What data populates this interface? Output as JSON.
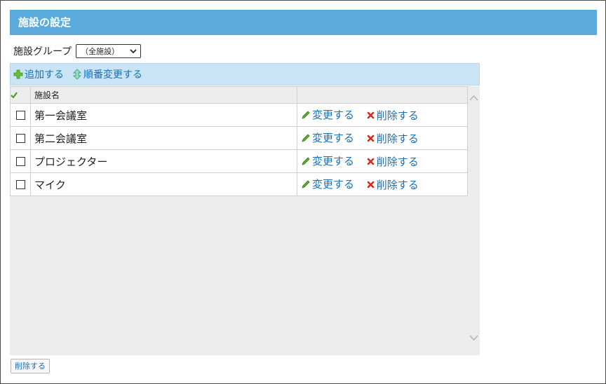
{
  "header": {
    "title": "施設の設定"
  },
  "group_filter": {
    "label": "施設グループ",
    "selected": "（全施設）"
  },
  "toolbar": {
    "add_label": "追加する",
    "reorder_label": "順番変更する"
  },
  "table": {
    "column_name": "施設名",
    "rows": [
      {
        "name": "第一会議室",
        "edit_label": "変更する",
        "delete_label": "削除する"
      },
      {
        "name": "第二会議室",
        "edit_label": "変更する",
        "delete_label": "削除する"
      },
      {
        "name": "プロジェクター",
        "edit_label": "変更する",
        "delete_label": "削除する"
      },
      {
        "name": "マイク",
        "edit_label": "変更する",
        "delete_label": "削除する"
      }
    ]
  },
  "footer": {
    "delete_button_label": "削除する"
  },
  "colors": {
    "title_bar": "#5aabdb",
    "toolbar": "#c9e4f4",
    "link": "#1a6fb3",
    "delete_x": "#d22a1e",
    "edit_pencil": "#4a9a24"
  }
}
